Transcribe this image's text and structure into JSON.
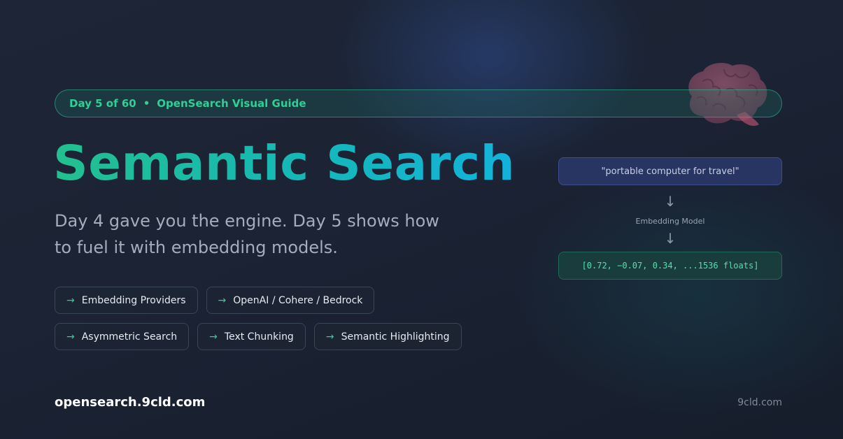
{
  "banner": {
    "day": "Day 5 of 60",
    "separator": "•",
    "series": "OpenSearch Visual Guide"
  },
  "title": "Semantic Search",
  "subtitle": "Day 4 gave you the engine. Day 5 shows how to fuel it with embedding models.",
  "tags": {
    "arrow": "→",
    "row1": [
      "Embedding Providers",
      "OpenAI / Cohere / Bedrock"
    ],
    "row2": [
      "Asymmetric Search",
      "Text Chunking",
      "Semantic Highlighting"
    ]
  },
  "flow": {
    "query": "\"portable computer for travel\"",
    "arrow": "↓",
    "model_label": "Embedding Model",
    "vector": "[0.72, −0.07, 0.34, ...1536 floats]"
  },
  "footer": {
    "url": "opensearch.9cld.com",
    "brand": "9cld.com"
  },
  "icons": {
    "brain": "brain-icon"
  },
  "colors": {
    "accent_green": "#2fcf95",
    "title_gradient_start": "#22c08f",
    "title_gradient_end": "#12b3dc",
    "background": "#1a2131"
  }
}
